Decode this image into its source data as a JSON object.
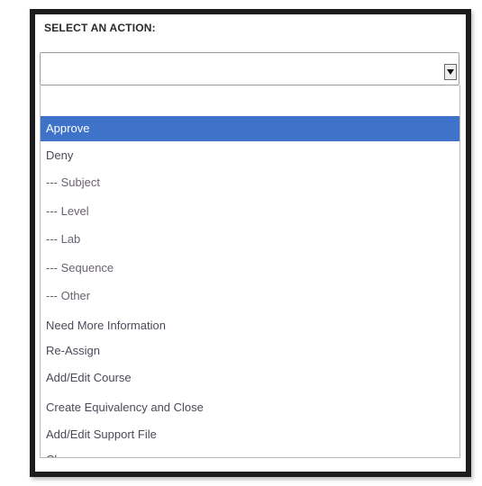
{
  "dialog": {
    "title": "SELECT AN ACTION:"
  },
  "select": {
    "current_value": "",
    "arrow_icon": "chevron-down-icon"
  },
  "colors": {
    "selected_bg": "#3f73c9",
    "selected_text": "#ffffff",
    "frame_border": "#1c1c1c"
  },
  "options": [
    {
      "label": "",
      "selected": false
    },
    {
      "label": "Approve",
      "selected": true
    },
    {
      "label": "Deny",
      "selected": false
    },
    {
      "label": "--- Subject",
      "selected": false
    },
    {
      "label": "--- Level",
      "selected": false
    },
    {
      "label": "--- Lab",
      "selected": false
    },
    {
      "label": "--- Sequence",
      "selected": false
    },
    {
      "label": "--- Other",
      "selected": false
    },
    {
      "label": "Need More Information",
      "selected": false
    },
    {
      "label": "Re-Assign",
      "selected": false
    },
    {
      "label": "Add/Edit Course",
      "selected": false
    },
    {
      "label": "Create Equivalency and Close",
      "selected": false
    },
    {
      "label": "Add/Edit Support File",
      "selected": false
    },
    {
      "label": "Close",
      "selected": false
    }
  ]
}
